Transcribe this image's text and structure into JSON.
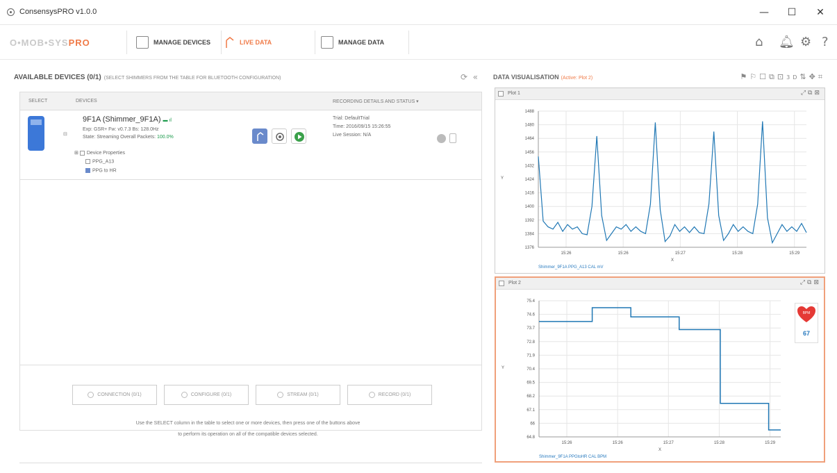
{
  "window": {
    "title": "ConsensysPRO v1.0.0",
    "minimize": "—",
    "maximize": "☐",
    "close": "✕"
  },
  "toolbar": {
    "logo_text": "O•MOB•SYS",
    "logo_pro": "PRO",
    "manage_devices": "MANAGE DEVICES",
    "live_data": "LIVE DATA",
    "manage_data": "MANAGE DATA",
    "icons": [
      "home-icon",
      "bell-icon",
      "gear-icon",
      "help-icon"
    ]
  },
  "devices_panel": {
    "title": "AVAILABLE DEVICES (0/1)",
    "subtitle": "(SELECT SHIMMERS FROM THE TABLE FOR BLUETOOTH CONFIGURATION)",
    "columns": {
      "select": "SELECT",
      "devices": "DEVICES",
      "recording": "RECORDING DETAILS AND STATUS ▾"
    },
    "device": {
      "name": "9F1A (Shimmer_9F1A)",
      "exp_line": "Exp: GSR+ Fw: v0.7.3 Bs: 128.0Hz",
      "state_label": "State: Streaming",
      "packets_label": "Overall Packets:",
      "packets_value": "100.0%",
      "tree": [
        "Device Properties",
        "PPG_A13",
        "PPG to HR"
      ],
      "trial": "Trial: DefaultTrial",
      "time": "Time: 2016/09/15 15:26:55",
      "session": "Live Session: N/A"
    },
    "buttons": {
      "connection": "CONNECTION (0/1)",
      "configure": "CONFIGURE (0/1)",
      "stream": "STREAM (0/1)",
      "record": "RECORD (0/1)"
    },
    "instructions_line1": "Use the SELECT column in the table to select one or more devices, then press one of the buttons above",
    "instructions_line2": "to perform its operation on all of the compatible devices selected."
  },
  "visualisation": {
    "title": "DATA VISUALISATION",
    "active": "(Active: Plot 2)",
    "plot1": {
      "name": "Plot 1",
      "y_ticks": [
        "1488",
        "1480",
        "1464",
        "1456",
        "1432",
        "1424",
        "1416",
        "1400",
        "1392",
        "1384",
        "1376"
      ],
      "x_ticks": [
        "15:26",
        "15:26",
        "15:27",
        "15:28",
        "15:29"
      ],
      "x_label": "X",
      "y_label": "Y",
      "series": "Shimmer_9F1A PPG_A13 CAL mV"
    },
    "plot2": {
      "name": "Plot 2",
      "y_ticks": [
        "75.4",
        "74.6",
        "73.7",
        "72.8",
        "71.9",
        "70.4",
        "69.5",
        "68.2",
        "67.1",
        "66",
        "64.8"
      ],
      "x_ticks": [
        "15:26",
        "15:26",
        "15:27",
        "15:28",
        "15:29"
      ],
      "x_label": "X",
      "y_label": "Y",
      "series": "Shimmer_9F1A PPGtoHR CAL BPM",
      "hr_label": "BPM",
      "hr_value": "67"
    }
  },
  "chart_data": [
    {
      "type": "line",
      "title": "Plot 1",
      "series": [
        {
          "name": "Shimmer_9F1A PPG_A13 CAL mV",
          "values": [
            1452,
            1395,
            1390,
            1388,
            1394,
            1386,
            1392,
            1388,
            1390,
            1384,
            1383,
            1408,
            1470,
            1400,
            1378,
            1384,
            1390,
            1388,
            1392,
            1386,
            1390,
            1386,
            1384,
            1410,
            1482,
            1405,
            1377,
            1382,
            1392,
            1386,
            1390,
            1385,
            1390,
            1385,
            1384,
            1410,
            1474,
            1400,
            1378,
            1384,
            1392,
            1386,
            1390,
            1386,
            1384,
            1410,
            1483,
            1398,
            1376,
            1384,
            1392,
            1386,
            1390,
            1386,
            1393,
            1385
          ]
        }
      ],
      "ylim": [
        1372,
        1492
      ],
      "color": "#1f77b4"
    },
    {
      "type": "line",
      "title": "Plot 2",
      "series": [
        {
          "name": "Shimmer_9F1A PPGtoHR CAL BPM",
          "steps": [
            [
              0,
              74.2
            ],
            [
              0.22,
              75.4
            ],
            [
              0.38,
              74.6
            ],
            [
              0.58,
              73.5
            ],
            [
              0.75,
              67.1
            ],
            [
              0.95,
              64.8
            ]
          ]
        }
      ],
      "ylim": [
        64.2,
        76.0
      ],
      "color": "#1f77b4"
    }
  ]
}
